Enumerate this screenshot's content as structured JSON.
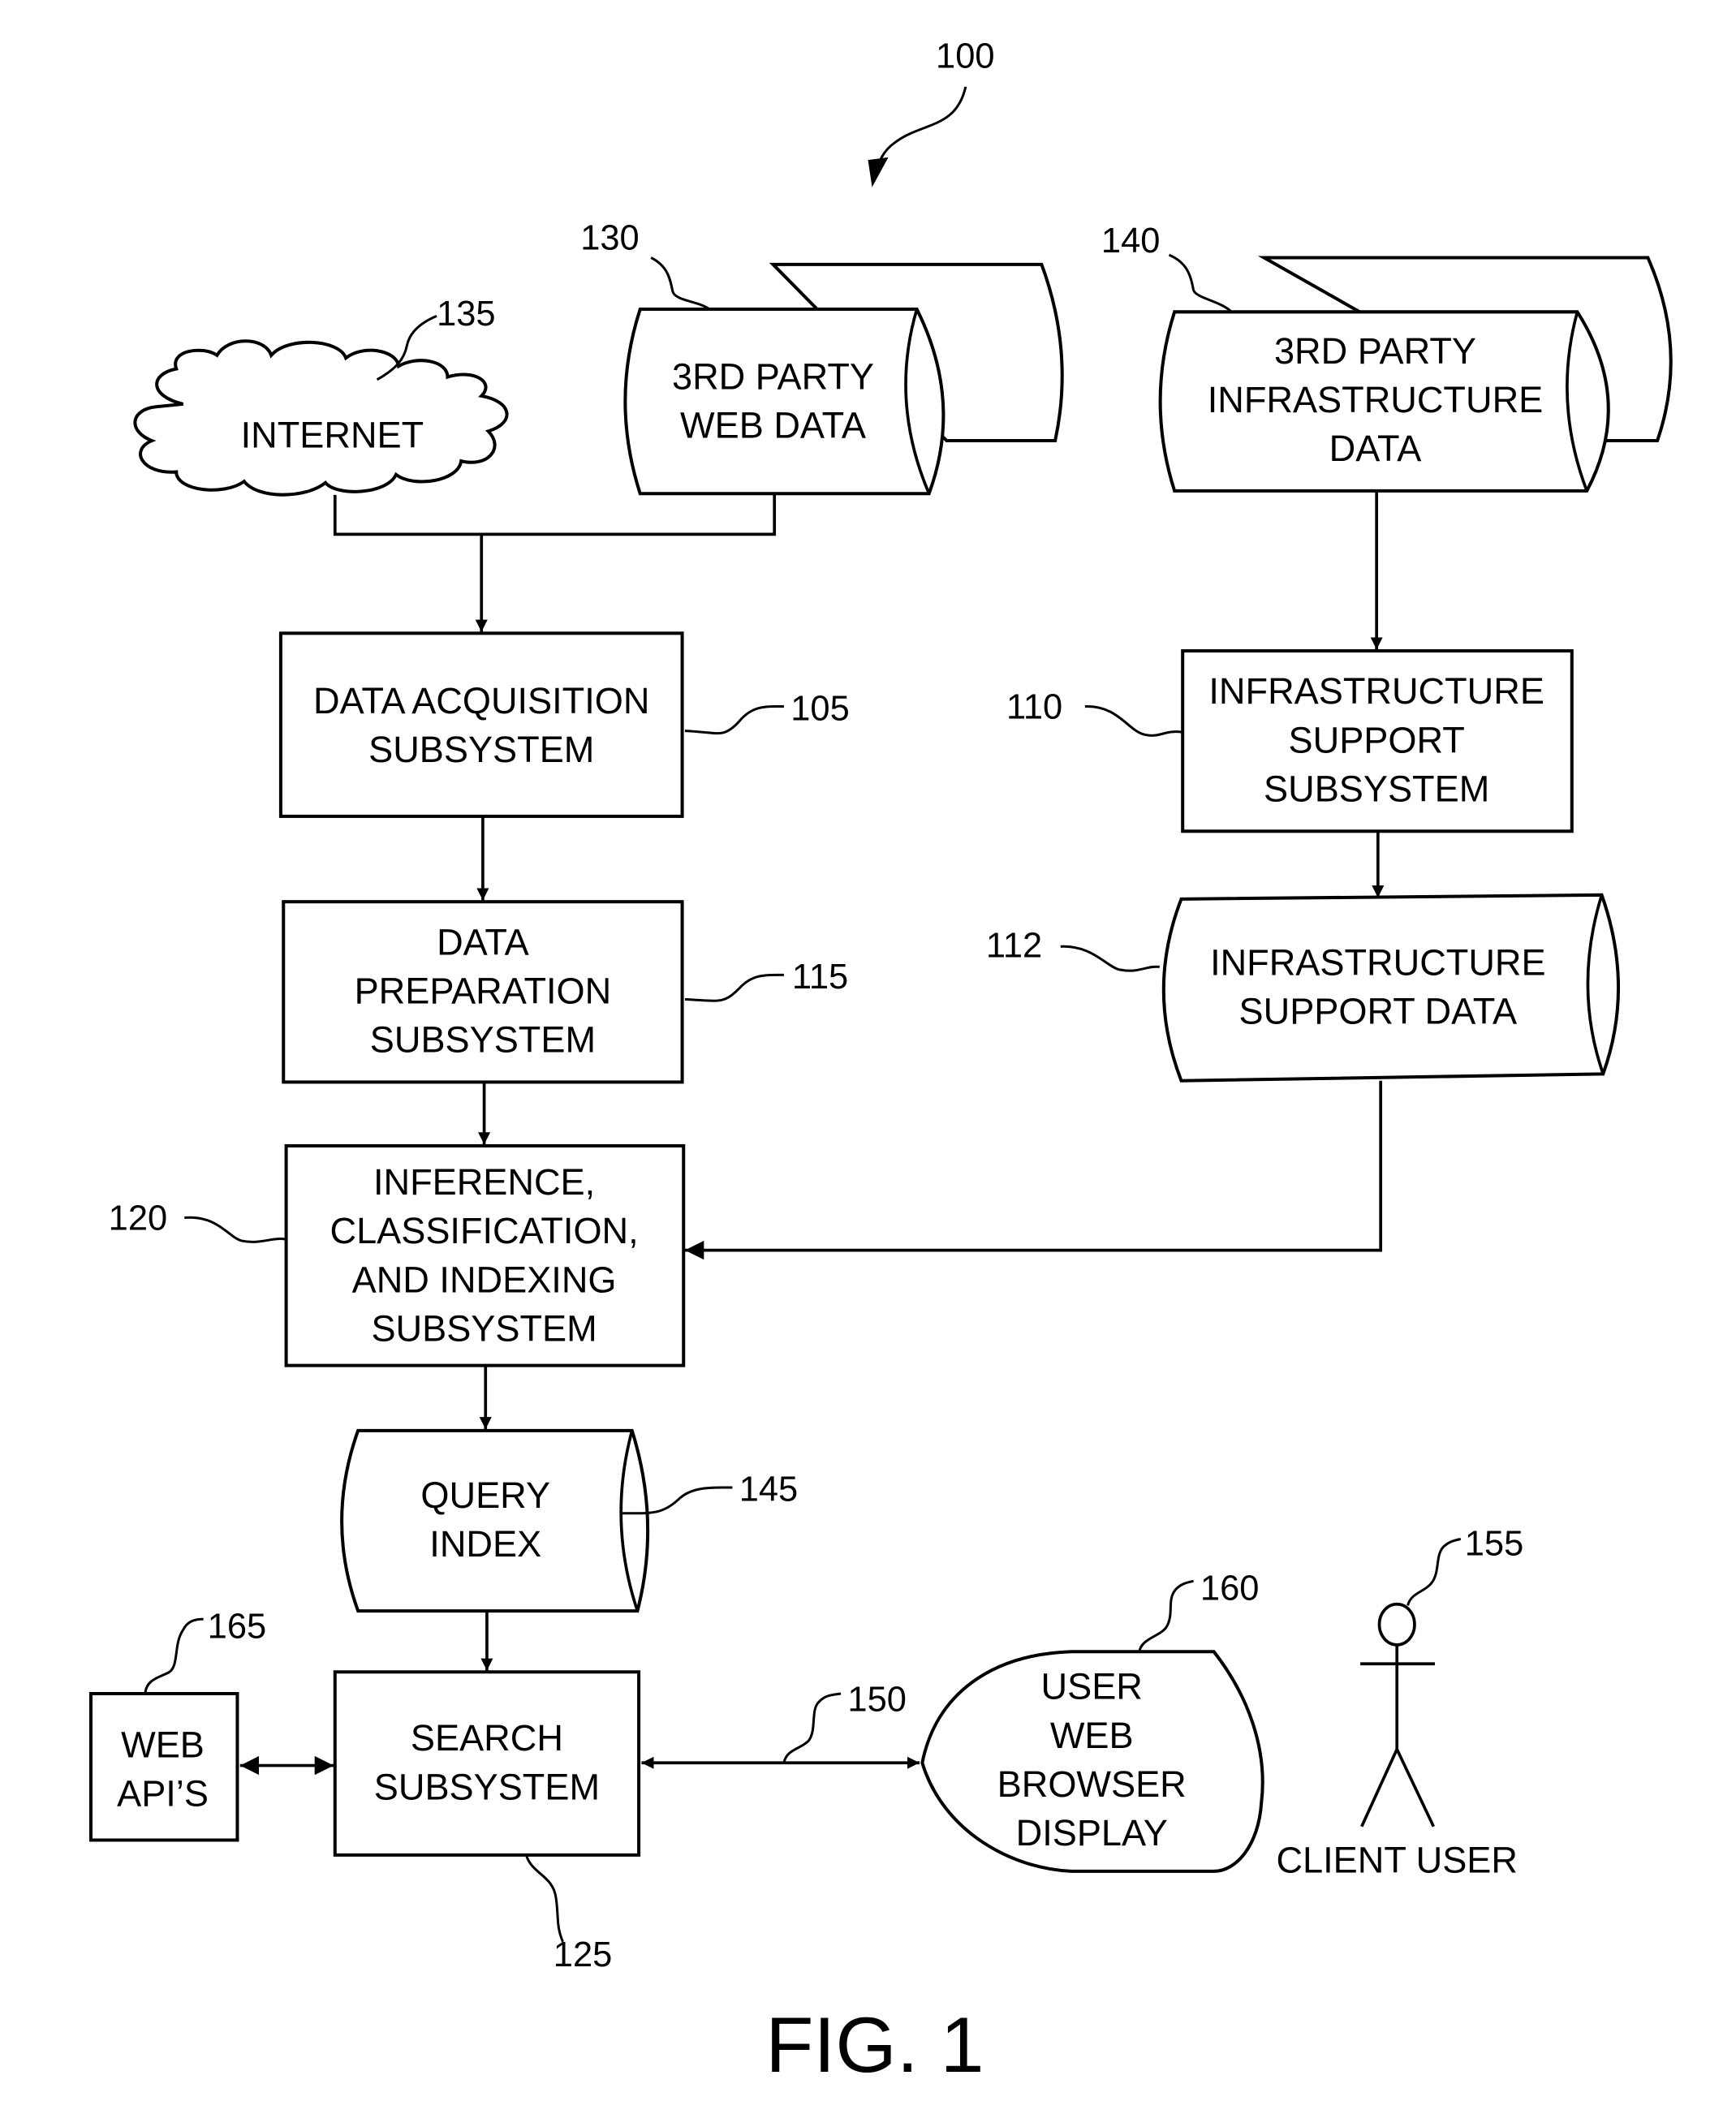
{
  "figure": {
    "caption": "FIG. 1",
    "system_ref": "100"
  },
  "nodes": {
    "internet": {
      "ref": "135",
      "lines": [
        "INTERNET"
      ],
      "shape": "cloud"
    },
    "web_data": {
      "ref": "130",
      "lines": [
        "3RD PARTY",
        "WEB DATA"
      ],
      "shape": "stacked-database"
    },
    "infra_data": {
      "ref": "140",
      "lines": [
        "3RD PARTY",
        "INFRASTRUCTURE",
        "DATA"
      ],
      "shape": "stacked-database"
    },
    "data_acquisition": {
      "ref": "105",
      "lines": [
        "DATA ACQUISITION",
        "SUBSYSTEM"
      ],
      "shape": "box"
    },
    "infra_support_subsystem": {
      "ref": "110",
      "lines": [
        "INFRASTRUCTURE",
        "SUPPORT",
        "SUBSYSTEM"
      ],
      "shape": "box"
    },
    "infra_support_data": {
      "ref": "112",
      "lines": [
        "INFRASTRUCTURE",
        "SUPPORT DATA"
      ],
      "shape": "database"
    },
    "data_preparation": {
      "ref": "115",
      "lines": [
        "DATA",
        "PREPARATION",
        "SUBSYSTEM"
      ],
      "shape": "box"
    },
    "inference": {
      "ref": "120",
      "lines": [
        "INFERENCE,",
        "CLASSIFICATION,",
        "AND INDEXING",
        "SUBSYSTEM"
      ],
      "shape": "box"
    },
    "query_index": {
      "ref": "145",
      "lines": [
        "QUERY",
        "INDEX"
      ],
      "shape": "database"
    },
    "web_apis": {
      "ref": "165",
      "lines": [
        "WEB",
        "API’S"
      ],
      "shape": "box"
    },
    "search": {
      "ref": "125",
      "lines": [
        "SEARCH",
        "SUBSYSTEM"
      ],
      "shape": "box"
    },
    "browser_display": {
      "ref": "160",
      "lines": [
        "USER",
        "WEB",
        "BROWSER",
        "DISPLAY"
      ],
      "shape": "display"
    },
    "client_user": {
      "ref": "155",
      "lines": [
        "CLIENT USER"
      ],
      "shape": "actor"
    }
  },
  "connections": [
    {
      "from": "internet",
      "to": "data_acquisition",
      "kind": "arrow"
    },
    {
      "from": "web_data",
      "to": "data_acquisition",
      "kind": "arrow"
    },
    {
      "from": "data_acquisition",
      "to": "data_preparation",
      "kind": "arrow"
    },
    {
      "from": "data_preparation",
      "to": "inference",
      "kind": "arrow"
    },
    {
      "from": "infra_data",
      "to": "infra_support_subsystem",
      "kind": "arrow"
    },
    {
      "from": "infra_support_subsystem",
      "to": "infra_support_data",
      "kind": "arrow"
    },
    {
      "from": "infra_support_data",
      "to": "inference",
      "kind": "arrow"
    },
    {
      "from": "inference",
      "to": "query_index",
      "kind": "arrow"
    },
    {
      "from": "query_index",
      "to": "search",
      "kind": "arrow"
    },
    {
      "from": "web_apis",
      "to": "search",
      "kind": "bidirectional"
    },
    {
      "from": "search",
      "to": "browser_display",
      "kind": "bidirectional",
      "ref": "150"
    }
  ]
}
